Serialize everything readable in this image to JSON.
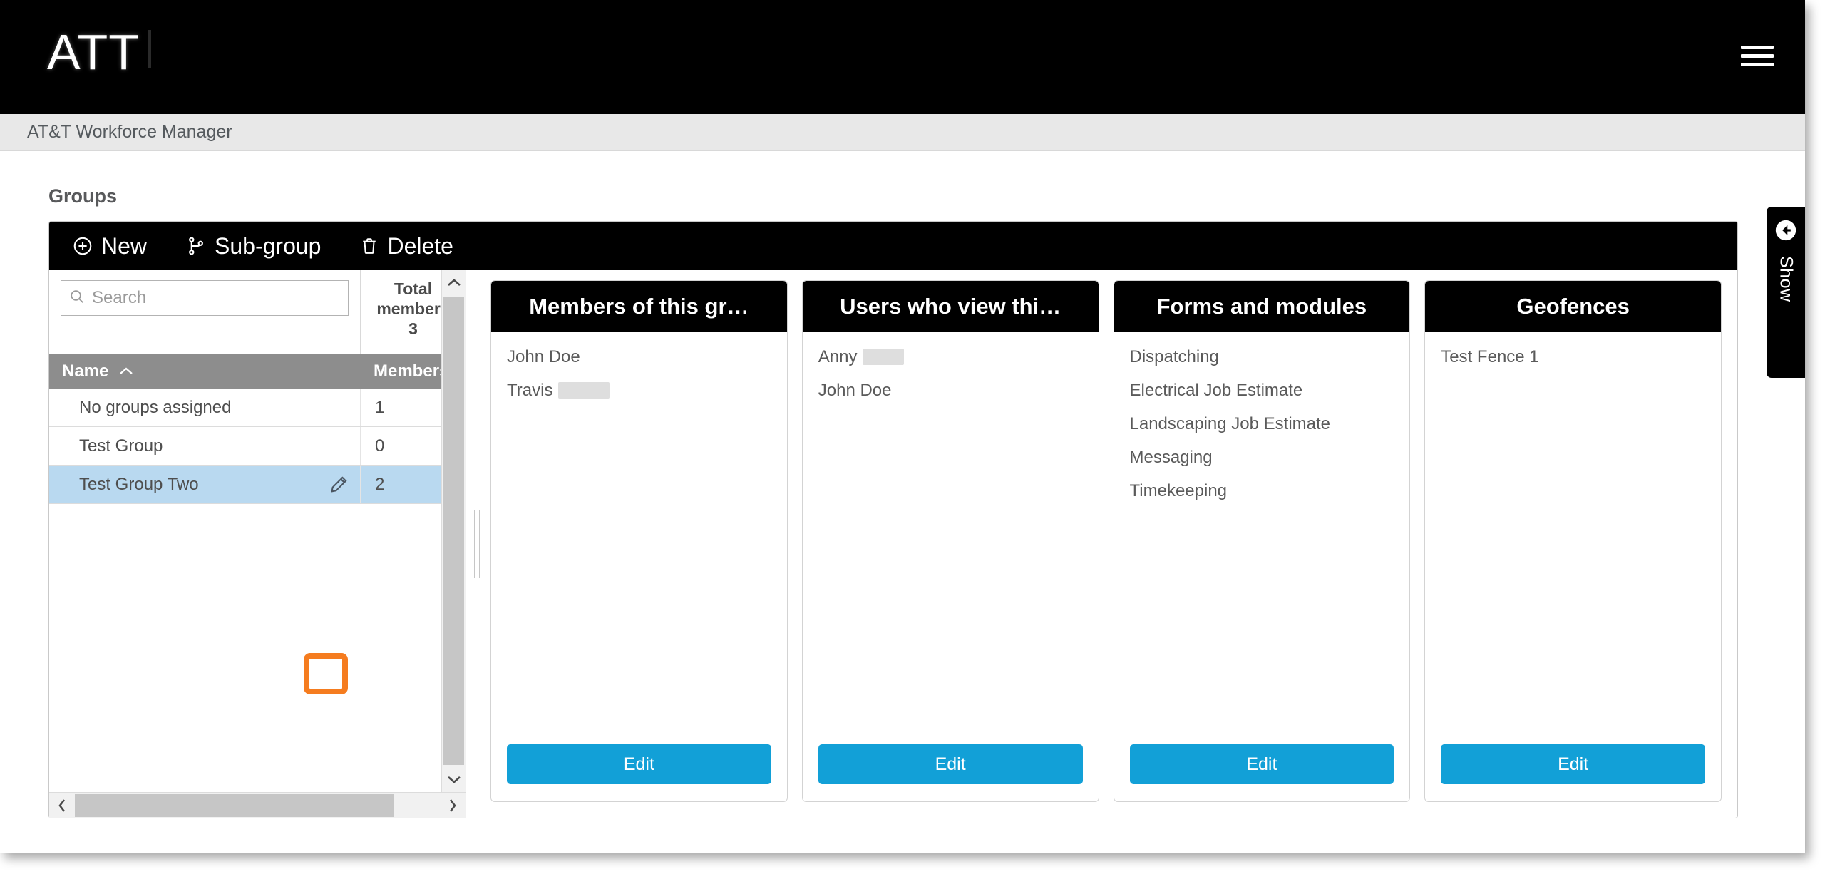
{
  "topbar": {
    "logo_text": "ATT",
    "menu_icon": "hamburger-icon"
  },
  "appbar": {
    "app_name": "AT&T Workforce Manager"
  },
  "page": {
    "title": "Groups"
  },
  "toolbar": {
    "new_label": "New",
    "subgroup_label": "Sub-group",
    "delete_label": "Delete"
  },
  "grid": {
    "search_placeholder": "Search",
    "search_value": "",
    "aggregate": {
      "line1": "Total",
      "line2": "members",
      "value": "3"
    },
    "columns": [
      {
        "label": "Name",
        "sort": "asc"
      },
      {
        "label": "Members"
      }
    ],
    "rows": [
      {
        "name": "No groups assigned",
        "members": "1",
        "selected": false
      },
      {
        "name": "Test Group",
        "members": "0",
        "selected": false
      },
      {
        "name": "Test Group Two",
        "members": "2",
        "selected": true
      }
    ],
    "row_edit_icon": "pencil-icon"
  },
  "cards": [
    {
      "title": "Members of this gr…",
      "items": [
        {
          "text": "John Doe",
          "redacted": false
        },
        {
          "text": "Travis",
          "redacted": true
        }
      ],
      "button": "Edit"
    },
    {
      "title": "Users who view thi…",
      "items": [
        {
          "text": "Anny",
          "redacted": true
        },
        {
          "text": "John Doe",
          "redacted": false
        }
      ],
      "button": "Edit"
    },
    {
      "title": "Forms and modules",
      "items": [
        {
          "text": "Dispatching",
          "redacted": false
        },
        {
          "text": "Electrical Job Estimate",
          "redacted": false
        },
        {
          "text": "Landscaping Job Estimate",
          "redacted": false
        },
        {
          "text": "Messaging",
          "redacted": false
        },
        {
          "text": "Timekeeping",
          "redacted": false
        }
      ],
      "button": "Edit"
    },
    {
      "title": "Geofences",
      "items": [
        {
          "text": "Test Fence 1",
          "redacted": false
        }
      ],
      "button": "Edit"
    }
  ],
  "side_tab": {
    "label": "Show",
    "icon": "arrow-left-circle-icon"
  },
  "colors": {
    "accent_blue": "#12a0d7",
    "highlight_orange": "#f57c1f",
    "selected_row": "#b9d9f0",
    "header_gray": "#8d8d8d",
    "black": "#000000"
  }
}
